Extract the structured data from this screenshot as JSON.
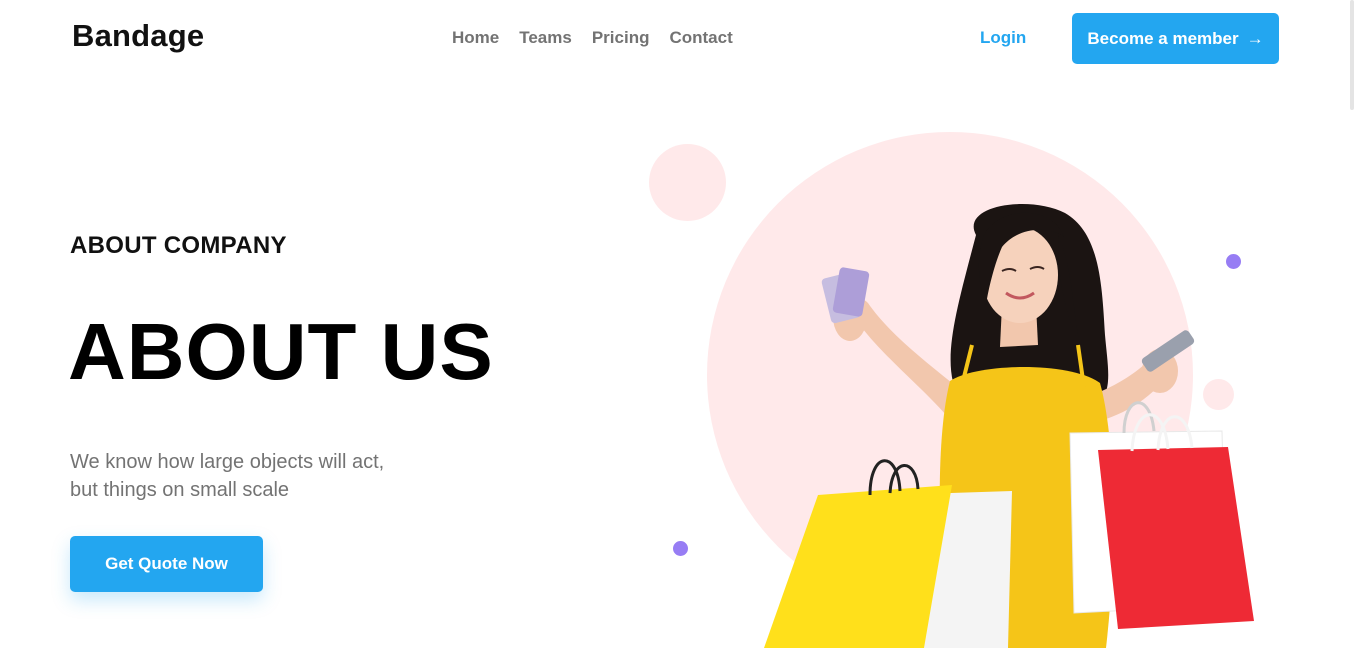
{
  "header": {
    "brand": "Bandage",
    "nav": [
      "Home",
      "Teams",
      "Pricing",
      "Contact"
    ],
    "login_label": "Login",
    "member_label": "Become a member",
    "member_icon": "arrow-right-icon"
  },
  "hero": {
    "eyebrow": "ABOUT COMPANY",
    "title": "ABOUT US",
    "text_line1": "We know how large objects will act,",
    "text_line2": "but things on small scale",
    "cta_label": "Get Quote Now"
  },
  "colors": {
    "primary": "#23A6F0",
    "heading": "#000000",
    "muted": "#737373",
    "pink": "#FFE9EA",
    "purple": "#977DF4"
  }
}
